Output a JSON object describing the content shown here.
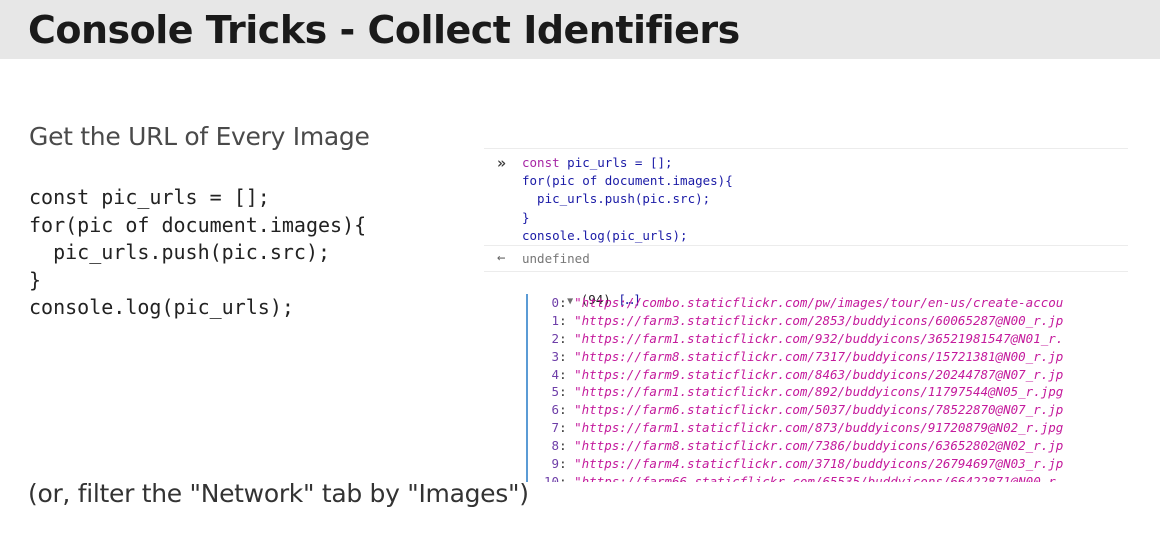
{
  "slide": {
    "title": "Console Tricks - Collect Identifiers",
    "subtitle": "Get the URL of Every Image",
    "code_lines": [
      "const pic_urls = [];",
      "for(pic of document.images){",
      "  pic_urls.push(pic.src);",
      "}",
      "console.log(pic_urls);"
    ],
    "footer_note": "(or, filter the \"Network\" tab by \"Images\")"
  },
  "console": {
    "prompt_icon": "double-chevron-prompt-icon",
    "prompt_glyph": "»",
    "input_lines": [
      "const pic_urls = [];",
      "for(pic of document.images){",
      "  pic_urls.push(pic.src);",
      "}",
      "console.log(pic_urls);"
    ],
    "return_icon": "return-arrow-icon",
    "return_glyph": "←",
    "return_value": "undefined",
    "array_toggle_glyph": "▼",
    "array_count": "(94)",
    "array_brackets": "[…]",
    "items": [
      {
        "index": "0",
        "url": "\"https://combo.staticflickr.com/pw/images/tour/en-us/create-accou"
      },
      {
        "index": "1",
        "url": "\"https://farm3.staticflickr.com/2853/buddyicons/60065287@N00_r.jp"
      },
      {
        "index": "2",
        "url": "\"https://farm1.staticflickr.com/932/buddyicons/36521981547@N01_r."
      },
      {
        "index": "3",
        "url": "\"https://farm8.staticflickr.com/7317/buddyicons/15721381@N00_r.jp"
      },
      {
        "index": "4",
        "url": "\"https://farm9.staticflickr.com/8463/buddyicons/20244787@N07_r.jp"
      },
      {
        "index": "5",
        "url": "\"https://farm1.staticflickr.com/892/buddyicons/11797544@N05_r.jpg"
      },
      {
        "index": "6",
        "url": "\"https://farm6.staticflickr.com/5037/buddyicons/78522870@N07_r.jp"
      },
      {
        "index": "7",
        "url": "\"https://farm1.staticflickr.com/873/buddyicons/91720879@N02_r.jpg"
      },
      {
        "index": "8",
        "url": "\"https://farm8.staticflickr.com/7386/buddyicons/63652802@N02_r.jp"
      },
      {
        "index": "9",
        "url": "\"https://farm4.staticflickr.com/3718/buddyicons/26794697@N03_r.jp"
      },
      {
        "index": "10",
        "url": "\"https://farm66.staticflickr.com/65535/buddyicons/66422871@N00_r"
      }
    ]
  }
}
